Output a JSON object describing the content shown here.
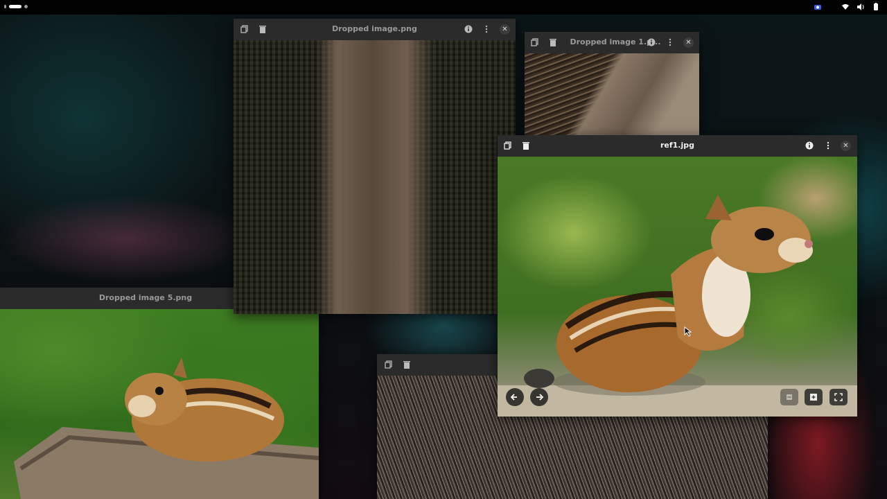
{
  "topbar": {
    "tray_icons": [
      "camera-icon",
      "wifi-icon",
      "volume-icon",
      "battery-icon"
    ]
  },
  "windows": {
    "w5": {
      "title": "Dropped image 5.png"
    },
    "w0": {
      "title": "Dropped image.png"
    },
    "w1": {
      "title": "Dropped image 1.p..."
    },
    "ref": {
      "title": "ref1.jpg"
    }
  },
  "colors": {
    "header": "#2b2b2b",
    "bar": "#000000",
    "accent": "#ffffff"
  }
}
